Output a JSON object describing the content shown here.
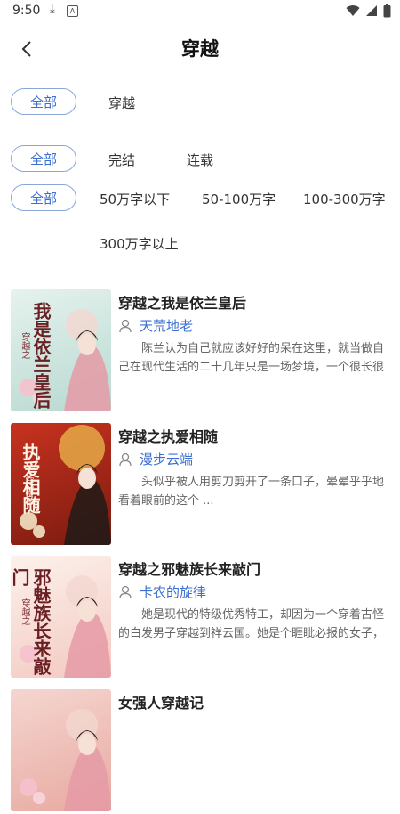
{
  "status": {
    "time": "9:50",
    "a_label": "A"
  },
  "header": {
    "title": "穿越"
  },
  "filters": {
    "category": {
      "all": "全部",
      "options": [
        "穿越"
      ]
    },
    "status": {
      "all": "全部",
      "options": [
        "完结",
        "连载"
      ]
    },
    "words": {
      "all": "全部",
      "options": [
        "50万字以下",
        "50-100万字",
        "100-300万字",
        "300万字以上"
      ]
    }
  },
  "books": [
    {
      "title": "穿越之我是依兰皇后",
      "author": "天荒地老",
      "desc": "陈兰认为自己就应该好好的呆在这里，就当做自己在现代生活的二十几年只是一场梦境，一个很长很长的…",
      "cover_text": "我是依兰皇后",
      "cover_sub": "穿越之",
      "cover_colors": [
        "#e6f2ee",
        "#b7d9d0"
      ]
    },
    {
      "title": "穿越之执爱相随",
      "author": "漫步云端",
      "desc": "头似乎被人用剪刀剪开了一条口子，晕晕乎乎地看着眼前的这个 ...",
      "cover_text": "执爱相随",
      "cover_sub": "穿越之",
      "cover_colors": [
        "#c8321f",
        "#7a1b10"
      ]
    },
    {
      "title": "穿越之邪魅族长来敲门",
      "author": "卡农的旋律",
      "desc": "她是现代的特级优秀特工，却因为一个穿着古怪的白发男子穿越到祥云国。她是个睚眦必报的女子，她可…",
      "cover_text": "邪魅族长来敲门",
      "cover_sub": "穿越之",
      "cover_colors": [
        "#fdf1ec",
        "#f2c9c0"
      ]
    },
    {
      "title": "女强人穿越记",
      "author": "",
      "desc": "",
      "cover_text": "",
      "cover_sub": "",
      "cover_colors": [
        "#f5d6d0",
        "#e7a9a0"
      ]
    }
  ]
}
